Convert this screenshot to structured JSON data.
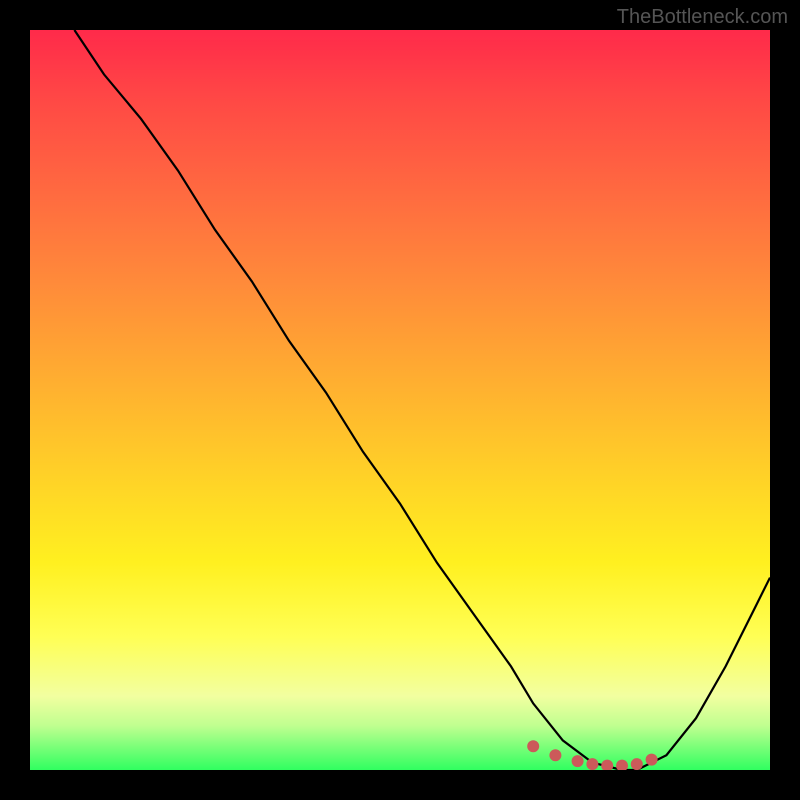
{
  "watermark": "TheBottleneck.com",
  "chart_data": {
    "type": "line",
    "title": "",
    "xlabel": "",
    "ylabel": "",
    "xlim": [
      0,
      100
    ],
    "ylim": [
      0,
      100
    ],
    "grid": false,
    "legend": false,
    "series": [
      {
        "name": "bottleneck-curve",
        "x": [
          6,
          10,
          15,
          20,
          25,
          30,
          35,
          40,
          45,
          50,
          55,
          60,
          65,
          68,
          72,
          76,
          80,
          82,
          86,
          90,
          94,
          98,
          100
        ],
        "values": [
          100,
          94,
          88,
          81,
          73,
          66,
          58,
          51,
          43,
          36,
          28,
          21,
          14,
          9,
          4,
          1,
          0,
          0,
          2,
          7,
          14,
          22,
          26
        ],
        "color": "#000000"
      }
    ],
    "highlight_points": {
      "name": "optimal-range-dots",
      "x": [
        68,
        71,
        74,
        76,
        78,
        80,
        82,
        84
      ],
      "values": [
        3.2,
        2.0,
        1.2,
        0.8,
        0.6,
        0.6,
        0.8,
        1.4
      ],
      "color": "#cc5a5a"
    },
    "gradient_stops": [
      {
        "pos": 0,
        "color": "#ff2a4a"
      },
      {
        "pos": 10,
        "color": "#ff4a45"
      },
      {
        "pos": 22,
        "color": "#ff6a40"
      },
      {
        "pos": 34,
        "color": "#ff8a3a"
      },
      {
        "pos": 48,
        "color": "#ffb030"
      },
      {
        "pos": 62,
        "color": "#ffd626"
      },
      {
        "pos": 72,
        "color": "#fff020"
      },
      {
        "pos": 82,
        "color": "#ffff55"
      },
      {
        "pos": 90,
        "color": "#f2ffa0"
      },
      {
        "pos": 94,
        "color": "#c0ff90"
      },
      {
        "pos": 100,
        "color": "#30ff60"
      }
    ]
  }
}
